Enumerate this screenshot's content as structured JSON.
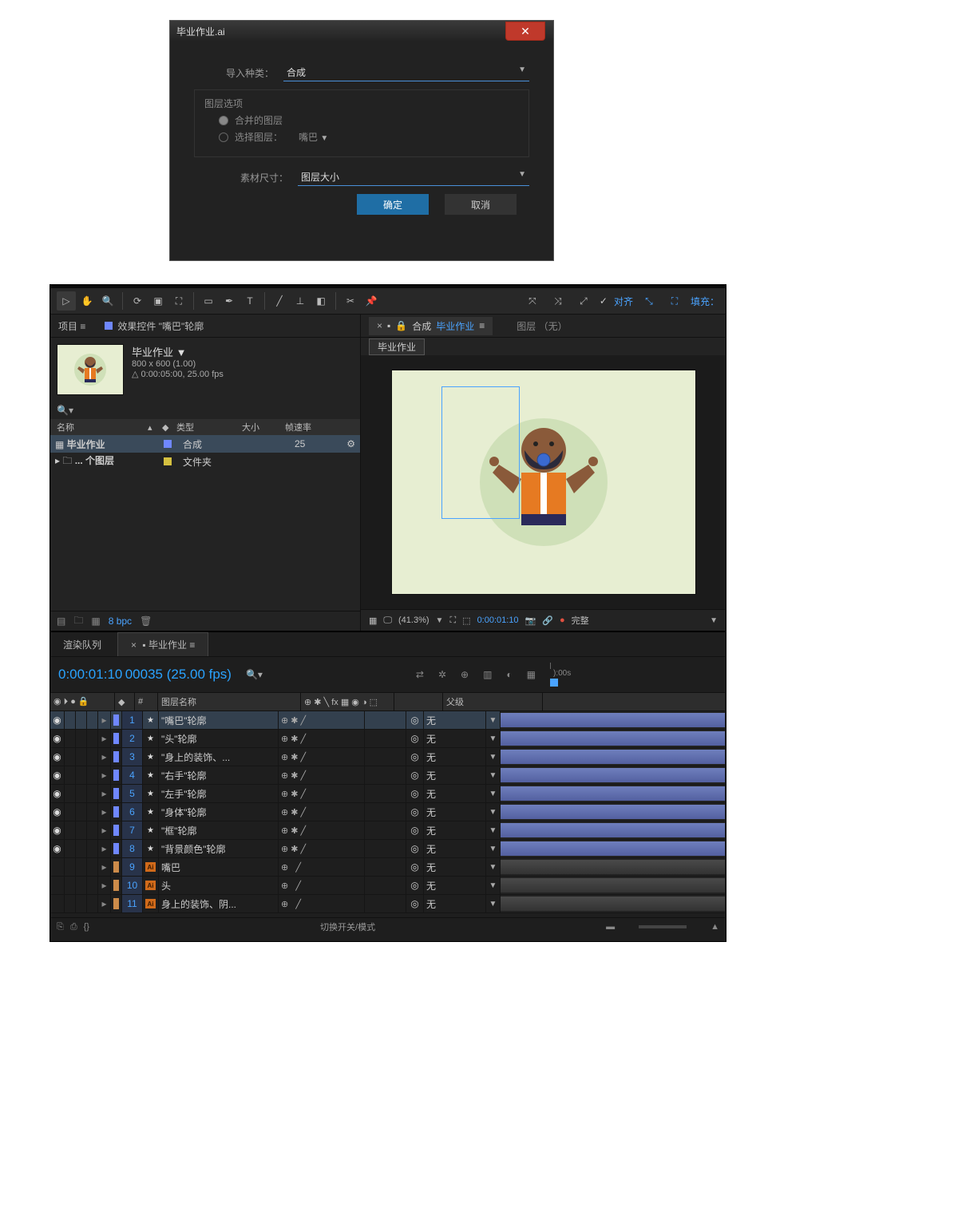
{
  "dialog": {
    "title": "毕业作业.ai",
    "import_type_label": "导入种类：",
    "import_type_value": "合成",
    "layer_options_legend": "图层选项",
    "merged_layers_label": "合并的图层",
    "choose_layer_label": "选择图层：",
    "choose_layer_value": "嘴巴",
    "footage_dim_label": "素材尺寸：",
    "footage_dim_value": "图层大小",
    "ok": "确定",
    "cancel": "取消"
  },
  "toolbar": {
    "align_label": "对齐",
    "fill_label": "填充："
  },
  "project": {
    "tab_project": "项目",
    "tab_effects": "效果控件 \"嘴巴\"轮廓",
    "comp_name": "毕业作业 ▼",
    "comp_dim": "800 x 600 (1.00)",
    "comp_dur": "△ 0:00:05:00, 25.00 fps",
    "col_name": "名称",
    "col_type": "类型",
    "col_size": "大小",
    "col_fps": "帧速率",
    "rows": [
      {
        "name": "毕业作业",
        "type": "合成",
        "fps": "25",
        "selected": true,
        "kind": "comp"
      },
      {
        "name": "... 个图层",
        "type": "文件夹",
        "fps": "",
        "selected": false,
        "kind": "folder"
      }
    ],
    "bpc": "8 bpc"
  },
  "viewer": {
    "comp_prefix": "合成",
    "comp_name": "毕业作业",
    "layer_tab": "图层 （无）",
    "chip": "毕业作业",
    "zoom": "(41.3%)",
    "time": "0:00:01:10",
    "quality": "完整"
  },
  "timeline": {
    "tab_render": "渲染队列",
    "tab_active": "毕业作业",
    "time": "0:00:01:10",
    "time_sub": "00035 (25.00 fps)",
    "ruler_start": "):00s",
    "hdr_eye": "◉ ⏵ ● 🔒",
    "hdr_layer_name": "图层名称",
    "hdr_switches": "⊕ ✱ ╲ fx 🎞 ◉ ◑ ⬚",
    "hdr_parent": "父级",
    "footer_toggle": "切换开关/模式",
    "layers": [
      {
        "n": 1,
        "name": "\"嘴巴\"轮廓",
        "shape": true,
        "eye": true,
        "parent": "无",
        "sel": true
      },
      {
        "n": 2,
        "name": "\"头\"轮廓",
        "shape": true,
        "eye": true,
        "parent": "无"
      },
      {
        "n": 3,
        "name": "\"身上的装饰、...",
        "shape": true,
        "eye": true,
        "parent": "无"
      },
      {
        "n": 4,
        "name": "\"右手\"轮廓",
        "shape": true,
        "eye": true,
        "parent": "无"
      },
      {
        "n": 5,
        "name": "\"左手\"轮廓",
        "shape": true,
        "eye": true,
        "parent": "无"
      },
      {
        "n": 6,
        "name": "\"身体\"轮廓",
        "shape": true,
        "eye": true,
        "parent": "无"
      },
      {
        "n": 7,
        "name": "\"框\"轮廓",
        "shape": true,
        "eye": true,
        "parent": "无"
      },
      {
        "n": 8,
        "name": "\"背景颜色\"轮廓",
        "shape": true,
        "eye": true,
        "parent": "无"
      },
      {
        "n": 9,
        "name": "嘴巴",
        "shape": false,
        "eye": false,
        "parent": "无"
      },
      {
        "n": 10,
        "name": "头",
        "shape": false,
        "eye": false,
        "parent": "无"
      },
      {
        "n": 11,
        "name": "身上的装饰、阴...",
        "shape": false,
        "eye": false,
        "parent": "无"
      }
    ]
  }
}
